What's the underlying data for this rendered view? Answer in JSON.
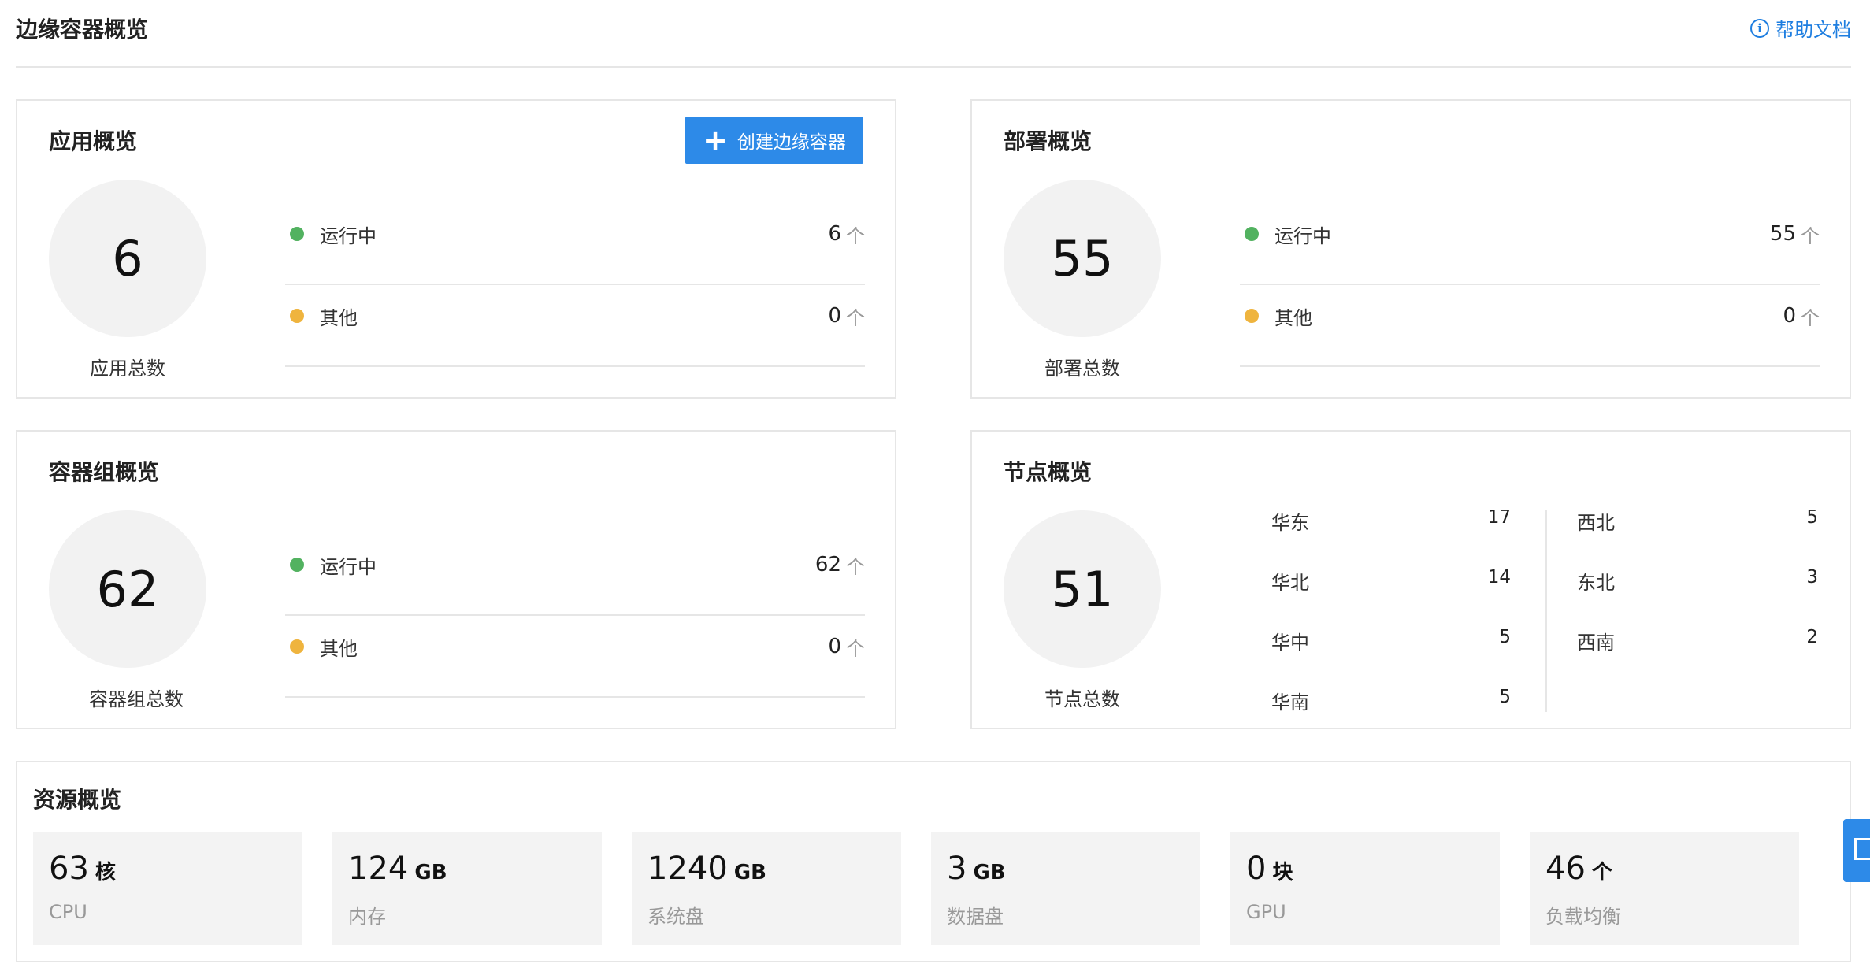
{
  "header": {
    "title": "边缘容器概览",
    "help_label": "帮助文档",
    "help_icon": "info-icon"
  },
  "apps": {
    "title": "应用概览",
    "create_label": "创建边缘容器",
    "total": "6",
    "total_label": "应用总数",
    "running_label": "运行中",
    "running_value": "6",
    "other_label": "其他",
    "other_value": "0",
    "unit": "个"
  },
  "deploy": {
    "title": "部署概览",
    "total": "55",
    "total_label": "部署总数",
    "running_label": "运行中",
    "running_value": "55",
    "other_label": "其他",
    "other_value": "0",
    "unit": "个"
  },
  "pods": {
    "title": "容器组概览",
    "total": "62",
    "total_label": "容器组总数",
    "running_label": "运行中",
    "running_value": "62",
    "other_label": "其他",
    "other_value": "0",
    "unit": "个"
  },
  "nodes": {
    "title": "节点概览",
    "total": "51",
    "total_label": "节点总数",
    "regions_left": [
      {
        "name": "华东",
        "count": "17"
      },
      {
        "name": "华北",
        "count": "14"
      },
      {
        "name": "华中",
        "count": "5"
      },
      {
        "name": "华南",
        "count": "5"
      }
    ],
    "regions_right": [
      {
        "name": "西北",
        "count": "5"
      },
      {
        "name": "东北",
        "count": "3"
      },
      {
        "name": "西南",
        "count": "2"
      }
    ]
  },
  "resources": {
    "title": "资源概览",
    "items": [
      {
        "value": "63",
        "unit": "核",
        "label": "CPU"
      },
      {
        "value": "124",
        "unit": "GB",
        "label": "内存"
      },
      {
        "value": "1240",
        "unit": "GB",
        "label": "系统盘"
      },
      {
        "value": "3",
        "unit": "GB",
        "label": "数据盘"
      },
      {
        "value": "0",
        "unit": "块",
        "label": "GPU"
      },
      {
        "value": "46",
        "unit": "个",
        "label": "负载均衡"
      }
    ]
  },
  "colors": {
    "accent": "#2d8ae8",
    "link": "#1e7ee0",
    "running": "#52b260",
    "other": "#efb43e"
  }
}
